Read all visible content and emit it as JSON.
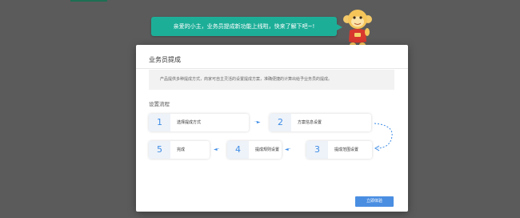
{
  "bubble": {
    "text": "亲爱的小主，业务员提成新功能上线啦，快来了解下吧~!"
  },
  "modal": {
    "title": "业务员提成",
    "description": "产品提供多种提成方式，商家可自主灵活的设置提成方案，准确便捷的计算出给予业务员的提成。",
    "section_title": "设置流程",
    "steps": [
      {
        "num": "1",
        "label": "选择提成方式"
      },
      {
        "num": "2",
        "label": "方案信息设置"
      },
      {
        "num": "3",
        "label": "提成范围设置"
      },
      {
        "num": "4",
        "label": "提成规则设置"
      },
      {
        "num": "5",
        "label": "完成"
      }
    ],
    "button_label": "立即体验"
  },
  "colors": {
    "backdrop": "#5b5b5b",
    "bubble": "#1dae98",
    "accent": "#3e8ce6",
    "button": "#4a8ee2"
  },
  "icons": {
    "mascot": "monkey-mascot",
    "arrow": "dotted-arrow"
  }
}
